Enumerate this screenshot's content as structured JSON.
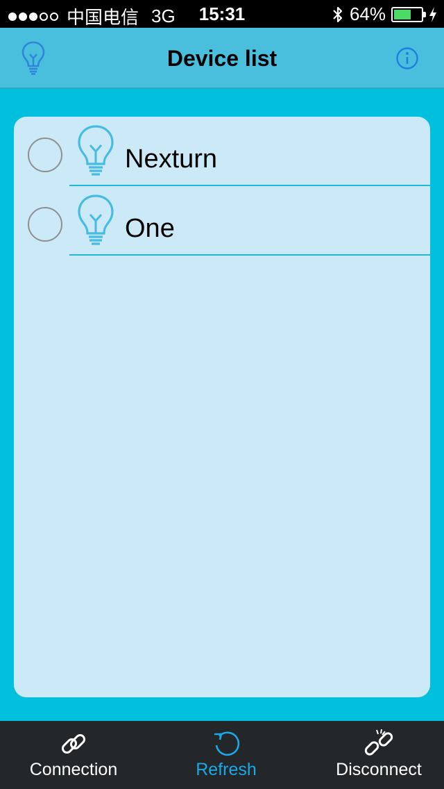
{
  "status_bar": {
    "carrier": "中国电信",
    "network": "3G",
    "time": "15:31",
    "battery": "64%",
    "battery_level": 0.64,
    "battery_color": "#4cd964"
  },
  "nav": {
    "title": "Device list",
    "left_icon": "lightbulb-icon",
    "right_icon": "info-icon"
  },
  "devices": [
    {
      "name": "Nexturn",
      "selected": false,
      "icon": "lightbulb-icon"
    },
    {
      "name": "One",
      "selected": false,
      "icon": "lightbulb-icon"
    }
  ],
  "tabs": [
    {
      "label": "Connection",
      "icon": "link-icon",
      "active": false
    },
    {
      "label": "Refresh",
      "icon": "refresh-icon",
      "active": true
    },
    {
      "label": "Disconnect",
      "icon": "broken-link-icon",
      "active": false
    }
  ],
  "colors": {
    "background": "#00c0dd",
    "navbar": "#49bfdd",
    "panel": "#cce9f8",
    "accent": "#19a9e8",
    "tabbar": "#242729"
  }
}
